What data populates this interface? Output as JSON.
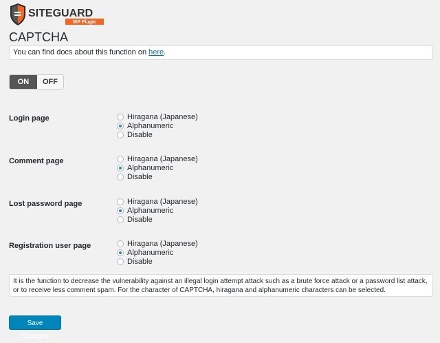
{
  "logo": {
    "brand_text": "SITEGUARD",
    "sub_text": "WP Plugin"
  },
  "page_title": "CAPTCHA",
  "notice": {
    "prefix": "You can find docs about this function on ",
    "link_text": "here",
    "suffix": "."
  },
  "toggle": {
    "on_label": "ON",
    "off_label": "OFF",
    "active": "ON"
  },
  "settings": [
    {
      "label": "Login page",
      "options": [
        "Hiragana (Japanese)",
        "Alphanumeric",
        "Disable"
      ],
      "selected": "Alphanumeric"
    },
    {
      "label": "Comment page",
      "options": [
        "Hiragana (Japanese)",
        "Alphanumeric",
        "Disable"
      ],
      "selected": "Alphanumeric"
    },
    {
      "label": "Lost password page",
      "options": [
        "Hiragana (Japanese)",
        "Alphanumeric",
        "Disable"
      ],
      "selected": "Alphanumeric"
    },
    {
      "label": "Registration user page",
      "options": [
        "Hiragana (Japanese)",
        "Alphanumeric",
        "Disable"
      ],
      "selected": "Alphanumeric"
    }
  ],
  "description": "It is the function to decrease the vulnerability against an illegal login attempt attack such as a brute force attack or a password list attack, or to receive less comment spam. For the character of CAPTCHA, hiragana and alphanumeric characters can be selected.",
  "save_button": "Save Changes",
  "colors": {
    "accent": "#0085ba",
    "toggle_active": "#555555",
    "brand_orange": "#f26522"
  },
  "icons": {
    "logo": "siteguard-shield-icon"
  }
}
